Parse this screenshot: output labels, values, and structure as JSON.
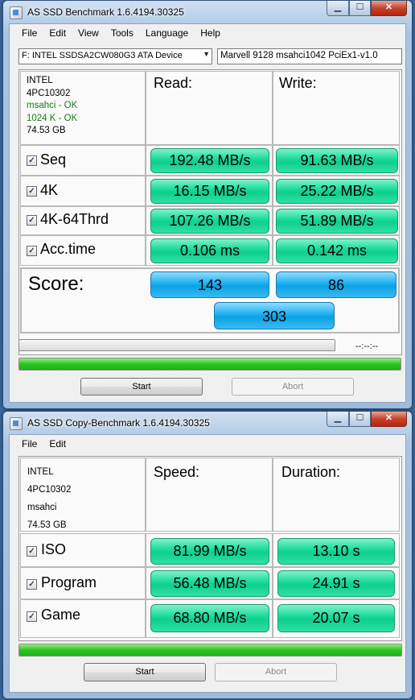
{
  "benchmark": {
    "title": "AS SSD Benchmark 1.6.4194.30325",
    "menu": [
      "File",
      "Edit",
      "View",
      "Tools",
      "Language",
      "Help"
    ],
    "drive_select": "F: INTEL SSDSA2CW080G3 ATA Device",
    "controller": "Marvell 9128 msahci1042 PciEx1-v1.0",
    "device": {
      "vendor": "INTEL",
      "firmware": "4PC10302",
      "driver": "msahci - OK",
      "alignment": "1024 K - OK",
      "size": "74.53 GB"
    },
    "headers": {
      "read": "Read:",
      "write": "Write:"
    },
    "tests": [
      {
        "label": "Seq",
        "checked": true,
        "read": "192.48 MB/s",
        "write": "91.63 MB/s"
      },
      {
        "label": "4K",
        "checked": true,
        "read": "16.15 MB/s",
        "write": "25.22 MB/s"
      },
      {
        "label": "4K-64Thrd",
        "checked": true,
        "read": "107.26 MB/s",
        "write": "51.89 MB/s"
      },
      {
        "label": "Acc.time",
        "checked": true,
        "read": "0.106 ms",
        "write": "0.142 ms"
      }
    ],
    "score": {
      "label": "Score:",
      "read": "143",
      "write": "86",
      "total": "303"
    },
    "time_display": "--:--:--",
    "progress_top": 0,
    "progress_bottom": 1.0,
    "buttons": {
      "start": "Start",
      "abort": "Abort"
    }
  },
  "copy": {
    "title": "AS SSD Copy-Benchmark 1.6.4194.30325",
    "menu": [
      "File",
      "Edit"
    ],
    "device": {
      "vendor": "INTEL",
      "firmware": "4PC10302",
      "driver": "msahci",
      "size": "74.53 GB"
    },
    "headers": {
      "speed": "Speed:",
      "duration": "Duration:"
    },
    "tests": [
      {
        "label": "ISO",
        "checked": true,
        "speed": "81.99 MB/s",
        "duration": "13.10 s"
      },
      {
        "label": "Program",
        "checked": true,
        "speed": "56.48 MB/s",
        "duration": "24.91 s"
      },
      {
        "label": "Game",
        "checked": true,
        "speed": "68.80 MB/s",
        "duration": "20.07 s"
      }
    ],
    "progress": 1.0,
    "buttons": {
      "start": "Start",
      "abort": "Abort"
    }
  },
  "colors": {
    "result_green": "#16d99a",
    "score_blue": "#1cb0ef",
    "progress_green": "#2ec323",
    "ok_text": "#1a7a1a"
  }
}
